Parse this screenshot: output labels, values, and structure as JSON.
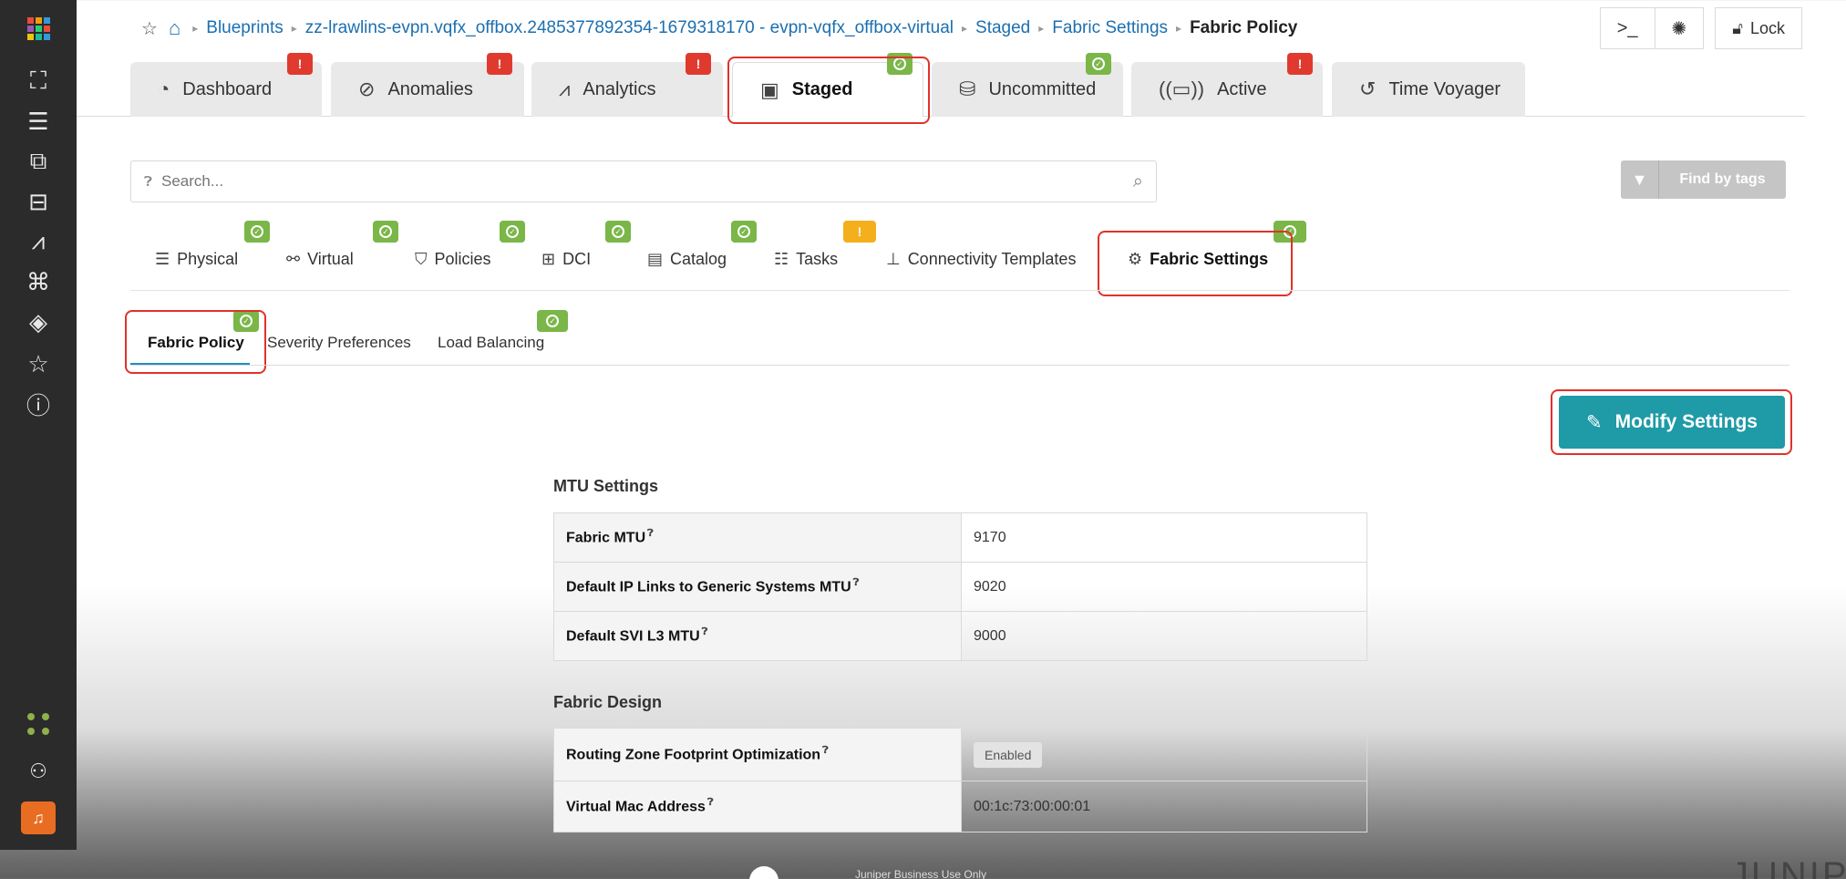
{
  "breadcrumb": {
    "items": [
      "Blueprints",
      "zz-lrawlins-evpn.vqfx_offbox.2485377892354-1679318170 - evpn-vqfx_offbox-virtual",
      "Staged",
      "Fabric Settings"
    ],
    "current": "Fabric Policy"
  },
  "top_actions": {
    "terminal": ">_",
    "bug": "✺",
    "lock_label": "Lock"
  },
  "main_tabs": [
    {
      "label": "Dashboard",
      "icon": "gauge-icon",
      "status": "warning"
    },
    {
      "label": "Anomalies",
      "icon": "anomaly-icon",
      "status": "warning"
    },
    {
      "label": "Analytics",
      "icon": "line-chart-icon",
      "status": "warning"
    },
    {
      "label": "Staged",
      "icon": "staged-file-icon",
      "status": "ok",
      "active": true
    },
    {
      "label": "Uncommitted",
      "icon": "uncommitted-icon",
      "status": "ok"
    },
    {
      "label": "Active",
      "icon": "active-signal-icon",
      "status": "warning"
    },
    {
      "label": "Time Voyager",
      "icon": "history-icon"
    }
  ],
  "search": {
    "placeholder": "Search..."
  },
  "find_by_tags": "Find by tags",
  "sub_tabs": [
    {
      "label": "Physical",
      "icon": "rack-icon",
      "status": "ok"
    },
    {
      "label": "Virtual",
      "icon": "virtual-network-icon",
      "status": "ok"
    },
    {
      "label": "Policies",
      "icon": "shield-check-icon",
      "status": "ok"
    },
    {
      "label": "DCI",
      "icon": "dci-icon",
      "status": "ok"
    },
    {
      "label": "Catalog",
      "icon": "catalog-icon",
      "status": "ok"
    },
    {
      "label": "Tasks",
      "icon": "tasks-list-icon",
      "status": "warning"
    },
    {
      "label": "Connectivity Templates",
      "icon": "tree-hierarchy-icon"
    },
    {
      "label": "Fabric Settings",
      "icon": "fabric-gear-icon",
      "status": "ok",
      "active": true
    }
  ],
  "settings_tabs": [
    {
      "label": "Fabric Policy",
      "status": "ok",
      "active": true
    },
    {
      "label": "Severity Preferences"
    },
    {
      "label": "Load Balancing",
      "status": "ok"
    }
  ],
  "modify_button": "Modify Settings",
  "mtu": {
    "title": "MTU Settings",
    "rows": [
      {
        "key": "Fabric MTU",
        "value": "9170"
      },
      {
        "key": "Default IP Links to Generic Systems MTU",
        "value": "9020"
      },
      {
        "key": "Default SVI L3 MTU",
        "value": "9000"
      }
    ]
  },
  "design": {
    "title": "Fabric Design",
    "rows": [
      {
        "key": "Routing Zone Footprint Optimization",
        "value": "Enabled"
      },
      {
        "key": "Virtual Mac Address",
        "value": "00:1c:73:00:00:01"
      }
    ]
  },
  "footer": {
    "note": "Juniper Business Use Only",
    "brand": "JUNIPE"
  },
  "colors": {
    "sidebar": "#2b2b2b",
    "link": "#1c6fb0",
    "ok": "#7ab648",
    "warn": "#e03a2f",
    "caution": "#f3b01c",
    "primary": "#1f9aa7",
    "highlight": "#e0322a"
  }
}
